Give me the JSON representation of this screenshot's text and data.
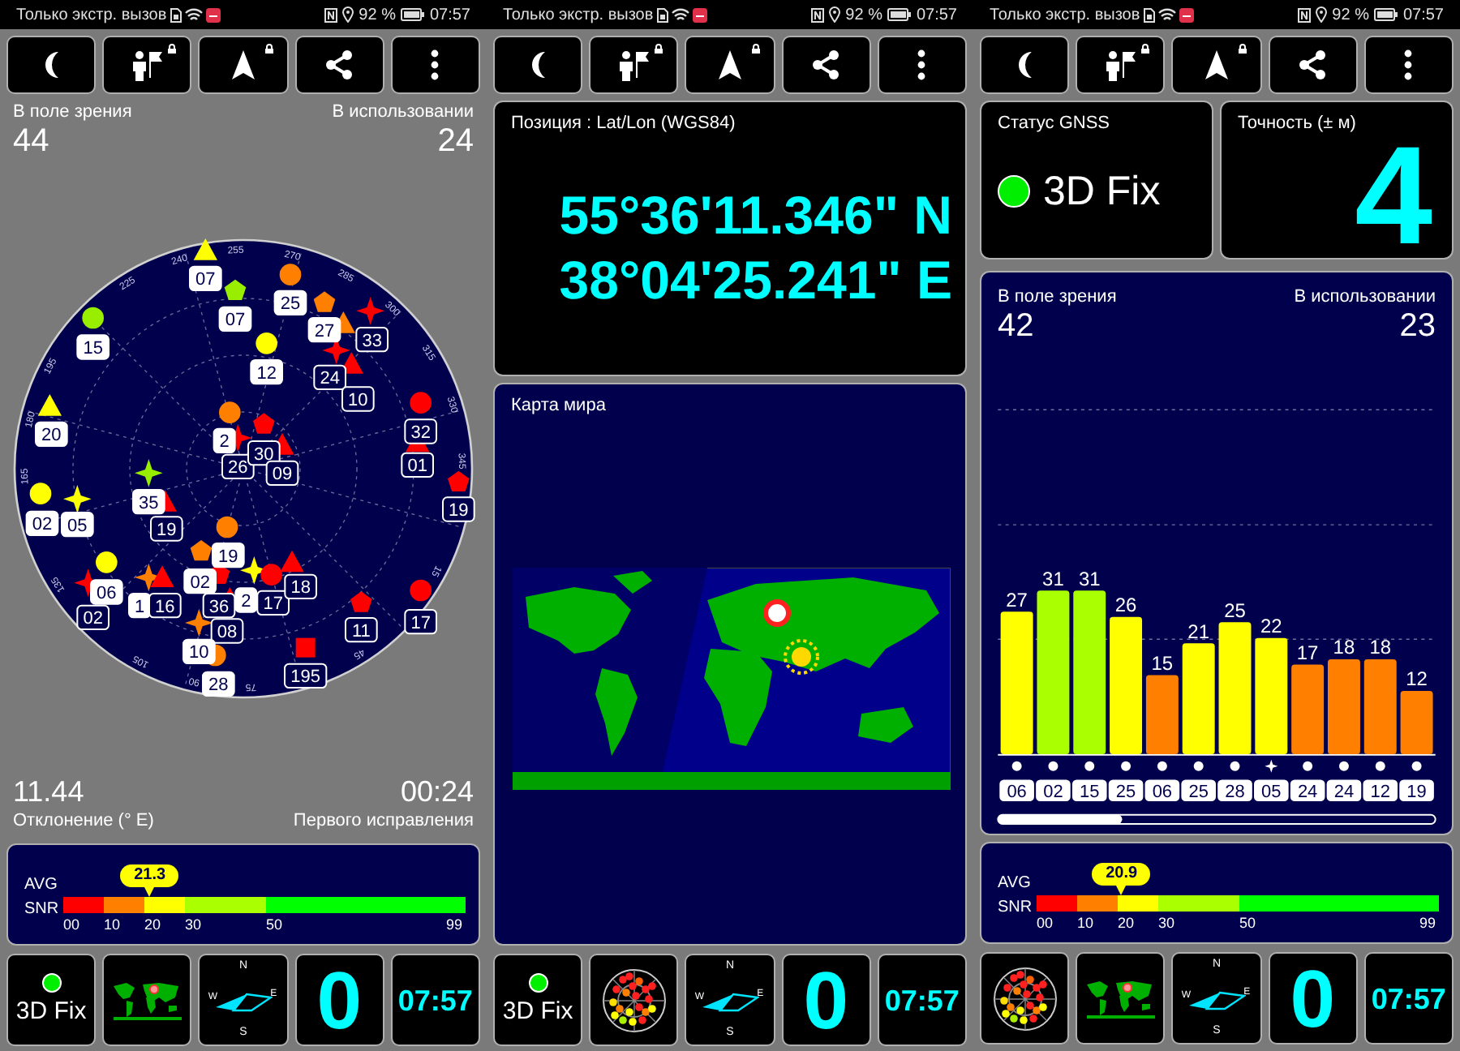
{
  "screens": [
    {
      "kind": "sky",
      "status_bar": {
        "carrier": "Только экстр. вызов",
        "battery": "92 %",
        "time": "07:57"
      },
      "toolbar": [
        {
          "kind": "night",
          "locked": false
        },
        {
          "kind": "poi",
          "locked": true
        },
        {
          "kind": "navigate",
          "locked": true
        },
        {
          "kind": "share",
          "locked": false
        },
        {
          "kind": "menu",
          "locked": false
        }
      ],
      "counts": {
        "in_view_label": "В поле зрения",
        "in_view": "44",
        "in_use_label": "В использовании",
        "in_use": "24"
      },
      "sky_plot": {
        "azimuth_labels": [
          "255",
          "270",
          "285",
          "300",
          "315",
          "330",
          "345",
          "15",
          "45",
          "75",
          "90",
          "105",
          "135",
          "165",
          "180",
          "195",
          "225",
          "240"
        ],
        "satellites": [
          {
            "kind": "triangle",
            "color": "#ffff00",
            "label": "07",
            "used": true
          },
          {
            "kind": "circle",
            "color": "#99ee00",
            "label": "15",
            "used": true
          },
          {
            "kind": "pentagon",
            "color": "#99ee00",
            "label": "07",
            "used": true
          },
          {
            "kind": "circle",
            "color": "#ff8000",
            "label": "25",
            "used": true
          },
          {
            "kind": "pentagon",
            "color": "#ff8000",
            "label": "27",
            "used": true
          },
          {
            "kind": "triangle",
            "color": "#ff8000"
          },
          {
            "kind": "star",
            "color": "#ff0000",
            "label": "33",
            "used": false
          },
          {
            "kind": "circle",
            "color": "#ffff00",
            "label": "12",
            "used": true
          },
          {
            "kind": "star",
            "color": "#ff0000",
            "label": "24",
            "used": false
          },
          {
            "kind": "triangle",
            "color": "#ff0000",
            "label": "10",
            "used": false
          },
          {
            "kind": "triangle",
            "color": "#ffff00",
            "label": "20",
            "used": true
          },
          {
            "kind": "circle",
            "color": "#ff8000",
            "label": "2",
            "used": true
          },
          {
            "kind": "star",
            "color": "#ff0000",
            "label": "26",
            "used": false
          },
          {
            "kind": "pentagon",
            "color": "#ff0000",
            "label": "30",
            "used": false
          },
          {
            "kind": "triangle",
            "color": "#ff0000",
            "label": "09",
            "used": false
          },
          {
            "kind": "circle",
            "color": "#ff0000",
            "label": "32",
            "used": false
          },
          {
            "kind": "triangle",
            "color": "#ff0000",
            "label": "01",
            "used": false
          },
          {
            "kind": "circle",
            "color": "#ffff00",
            "label": "02",
            "used": true
          },
          {
            "kind": "star",
            "color": "#ffff00",
            "label": "05",
            "used": true
          },
          {
            "kind": "star",
            "color": "#99ee00",
            "label": "35",
            "used": true
          },
          {
            "kind": "triangle",
            "color": "#ff0000",
            "label": "19",
            "used": false
          },
          {
            "kind": "pentagon",
            "color": "#ff0000",
            "label": "19",
            "used": false
          },
          {
            "kind": "circle",
            "color": "#ff8000",
            "label": "19",
            "used": true
          },
          {
            "kind": "circle",
            "color": "#ffff00",
            "label": "06",
            "used": true
          },
          {
            "kind": "star",
            "color": "#ff8000",
            "label": "1",
            "used": true
          },
          {
            "kind": "triangle",
            "color": "#ff0000",
            "label": "16",
            "used": false
          },
          {
            "kind": "pentagon",
            "color": "#ff8000",
            "label": "02",
            "used": true
          },
          {
            "kind": "pentagon",
            "color": "#ff0000",
            "label": "36",
            "used": false
          },
          {
            "kind": "star",
            "color": "#ffff00",
            "label": "2",
            "used": true
          },
          {
            "kind": "circle",
            "color": "#ff0000",
            "label": "17",
            "used": false
          },
          {
            "kind": "triangle",
            "color": "#ff0000",
            "label": "18",
            "used": false
          },
          {
            "kind": "star",
            "color": "#ff0000",
            "label": "02",
            "used": false
          },
          {
            "kind": "triangle",
            "color": "#ff0000",
            "label": "08",
            "used": false
          },
          {
            "kind": "pentagon",
            "color": "#ff0000",
            "label": "11",
            "used": false
          },
          {
            "kind": "circle",
            "color": "#ff0000",
            "label": "17",
            "used": false
          },
          {
            "kind": "star",
            "color": "#ff8000",
            "label": "10",
            "used": true
          },
          {
            "kind": "circle",
            "color": "#ff8000",
            "label": "28",
            "used": true
          },
          {
            "kind": "square",
            "color": "#ff0000",
            "label": "195",
            "used": false
          }
        ]
      },
      "footer": {
        "declination": "11.44",
        "declination_label": "Отклонение (° E)",
        "ttff": "00:24",
        "ttff_label": "Первого исправления"
      },
      "snr": {
        "row1": "AVG",
        "row2": "SNR",
        "value": "21.3",
        "level": 0.215,
        "ticks": [
          "00",
          "10",
          "20",
          "30",
          "50",
          "99"
        ]
      },
      "tiles": [
        {
          "kind": "fix",
          "text": "3D Fix"
        },
        {
          "kind": "map"
        },
        {
          "kind": "compass",
          "n": "N",
          "e": "E",
          "s": "S",
          "w": "W"
        },
        {
          "kind": "speed",
          "text": "0"
        },
        {
          "kind": "clock",
          "text": "07:57"
        }
      ]
    },
    {
      "kind": "position",
      "status_bar": {
        "carrier": "Только экстр. вызов",
        "battery": "92 %",
        "time": "07:57"
      },
      "toolbar": [
        {
          "kind": "night",
          "locked": false
        },
        {
          "kind": "poi",
          "locked": true
        },
        {
          "kind": "navigate",
          "locked": true
        },
        {
          "kind": "share",
          "locked": false
        },
        {
          "kind": "menu",
          "locked": false
        }
      ],
      "position": {
        "title": "Позиция : Lat/Lon (WGS84)",
        "lat": "55°36'11.346\" N",
        "lon": "38°04'25.241\" E"
      },
      "map": {
        "title": "Карта мира",
        "kind": "picture"
      },
      "tiles": [
        {
          "kind": "fix",
          "text": "3D Fix"
        },
        {
          "kind": "radar"
        },
        {
          "kind": "compass",
          "n": "N",
          "e": "E",
          "s": "S",
          "w": "W"
        },
        {
          "kind": "speed",
          "text": "0"
        },
        {
          "kind": "clock",
          "text": "07:57"
        }
      ]
    },
    {
      "kind": "signal",
      "status_bar": {
        "carrier": "Только экстр. вызов",
        "battery": "92 %",
        "time": "07:57"
      },
      "toolbar": [
        {
          "kind": "night",
          "locked": false
        },
        {
          "kind": "poi",
          "locked": true
        },
        {
          "kind": "navigate",
          "locked": true
        },
        {
          "kind": "share",
          "locked": false
        },
        {
          "kind": "menu",
          "locked": false
        }
      ],
      "status": {
        "title": "Статус GNSS",
        "fix": "3D Fix"
      },
      "accuracy": {
        "title": "Точность (± м)",
        "value": "4"
      },
      "signal_chart": {
        "in_view_label": "В поле зрения",
        "in_view": "42",
        "in_use_label": "В использовании",
        "in_use": "23",
        "markers": [
          {
            "kind": "dot"
          },
          {
            "kind": "dot"
          },
          {
            "kind": "dot"
          },
          {
            "kind": "dot"
          },
          {
            "kind": "dot"
          },
          {
            "kind": "dot"
          },
          {
            "kind": "dot"
          },
          {
            "kind": "star"
          },
          {
            "kind": "dot"
          },
          {
            "kind": "dot"
          },
          {
            "kind": "dot"
          },
          {
            "kind": "dot"
          }
        ],
        "chart_data": {
          "type": "bar",
          "categories": [
            "06",
            "02",
            "15",
            "25",
            "06",
            "25",
            "28",
            "05",
            "24",
            "24",
            "12",
            "19"
          ],
          "values": [
            27,
            31,
            31,
            26,
            15,
            21,
            25,
            22,
            17,
            18,
            18,
            12
          ],
          "data_labels": true
        }
      },
      "snr": {
        "row1": "AVG",
        "row2": "SNR",
        "value": "20.9",
        "level": 0.211,
        "ticks": [
          "00",
          "10",
          "20",
          "30",
          "50",
          "99"
        ]
      },
      "tiles": [
        {
          "kind": "radar"
        },
        {
          "kind": "map"
        },
        {
          "kind": "compass",
          "n": "N",
          "e": "E",
          "s": "S",
          "w": "W"
        },
        {
          "kind": "speed",
          "text": "0"
        },
        {
          "kind": "clock",
          "text": "07:57"
        }
      ]
    }
  ]
}
